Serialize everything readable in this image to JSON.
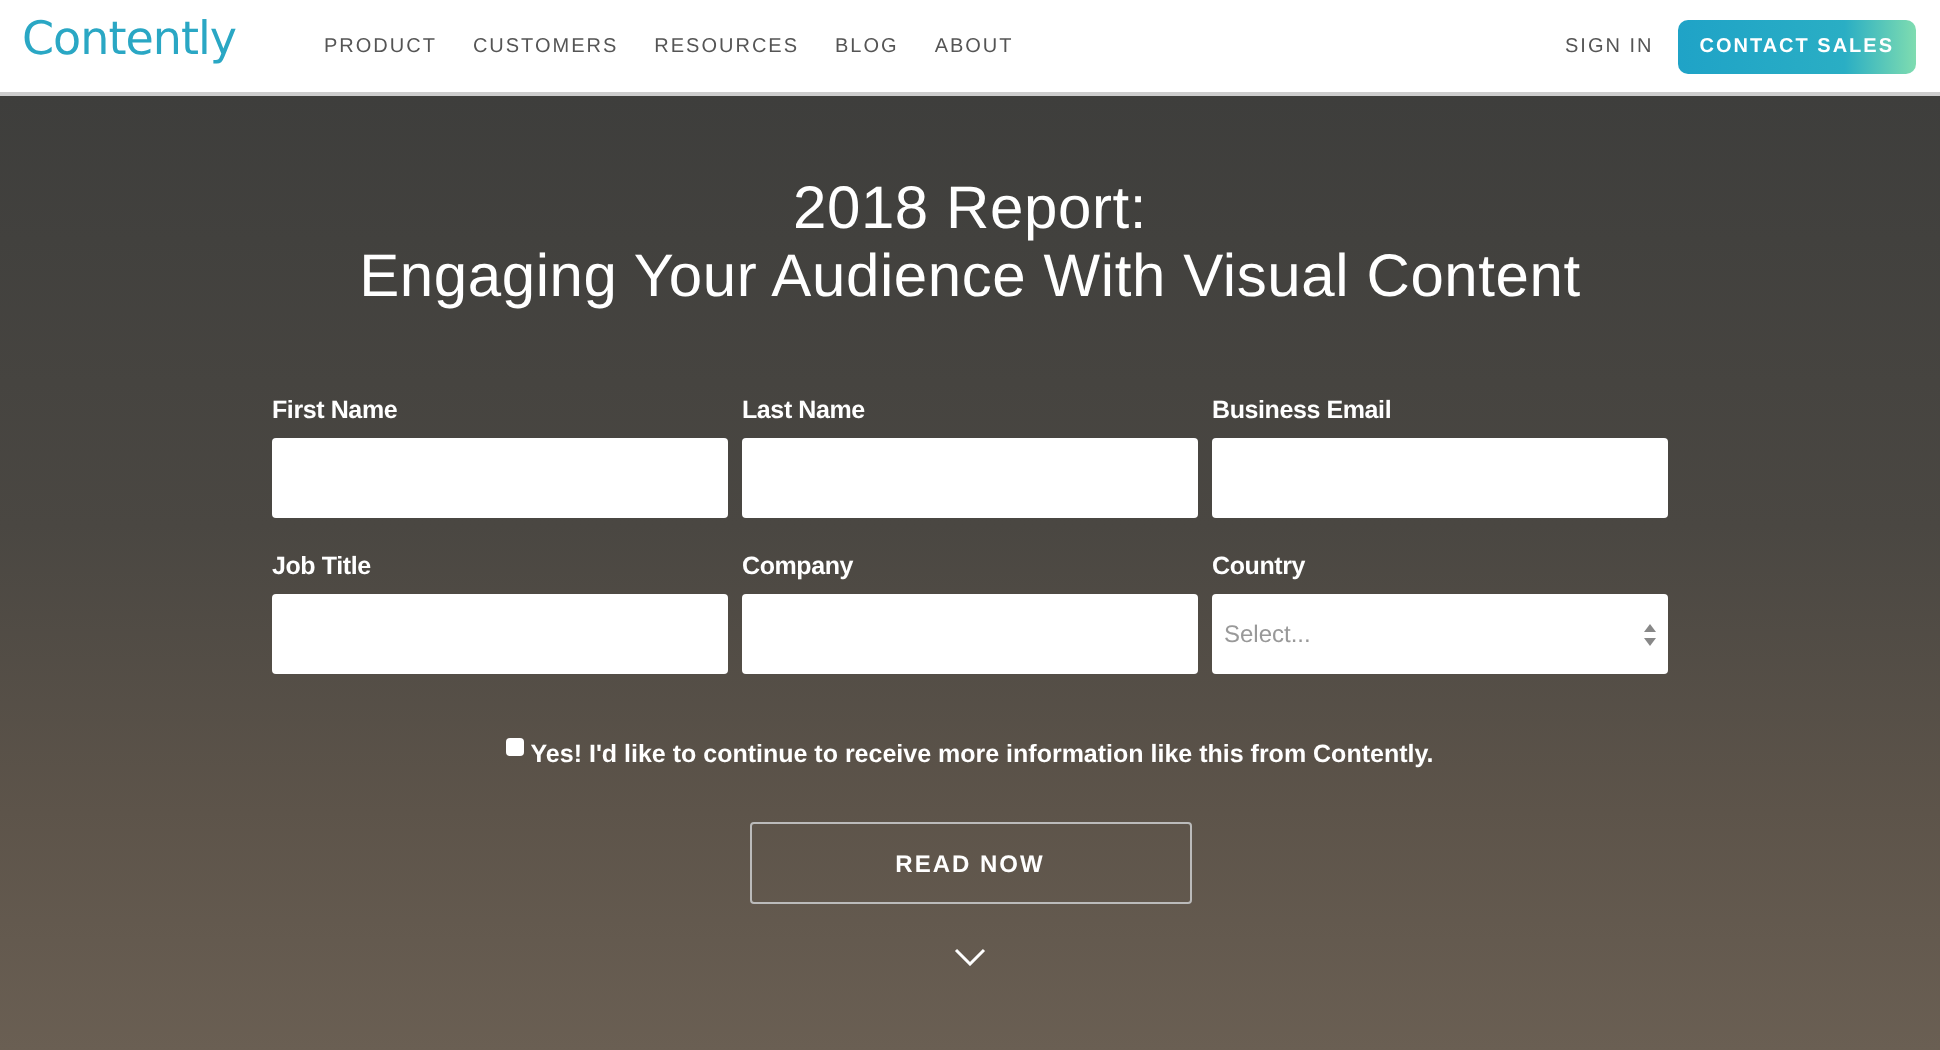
{
  "header": {
    "logo": "Contently",
    "nav": [
      {
        "label": "PRODUCT"
      },
      {
        "label": "CUSTOMERS"
      },
      {
        "label": "RESOURCES"
      },
      {
        "label": "BLOG"
      },
      {
        "label": "ABOUT"
      }
    ],
    "sign_in": "SIGN IN",
    "cta": "CONTACT SALES"
  },
  "hero": {
    "title_lines": [
      "2018 Report:",
      "Engaging Your Audience With Visual Content"
    ],
    "fields": [
      {
        "label": "First Name",
        "kind": "text"
      },
      {
        "label": "Last Name",
        "kind": "text"
      },
      {
        "label": "Business Email",
        "kind": "text"
      },
      {
        "label": "Job Title",
        "kind": "text"
      },
      {
        "label": "Company",
        "kind": "text"
      },
      {
        "label": "Country",
        "kind": "select",
        "placeholder": "Select..."
      }
    ],
    "opt_in": {
      "label": "Yes! I'd like to continue to receive more information like this from Contently.",
      "checked": false
    },
    "button": "READ NOW"
  }
}
